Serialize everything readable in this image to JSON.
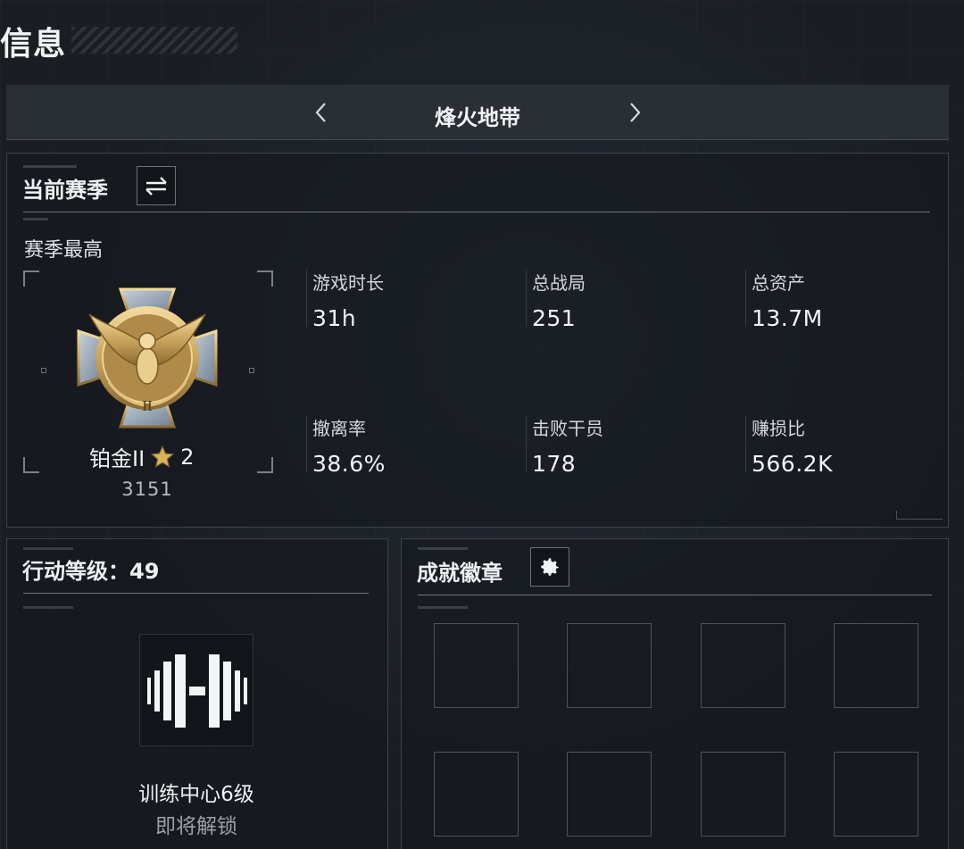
{
  "page": {
    "title": "信息"
  },
  "mode_switcher": {
    "title": "烽火地带"
  },
  "season_panel": {
    "title": "当前赛季",
    "subtitle": "赛季最高",
    "rank": {
      "name": "铂金II",
      "stars": "2",
      "score": "3151",
      "tier_numeral": "II"
    },
    "stats": [
      {
        "label": "游戏时长",
        "value": "31h"
      },
      {
        "label": "总战局",
        "value": "251"
      },
      {
        "label": "总资产",
        "value": "13.7M"
      },
      {
        "label": "撤离率",
        "value": "38.6%"
      },
      {
        "label": "击败干员",
        "value": "178"
      },
      {
        "label": "赚损比",
        "value": "566.2K"
      }
    ]
  },
  "level_panel": {
    "title": "行动等级：49",
    "unlock_name": "训练中心6级",
    "unlock_status": "即将解锁"
  },
  "badges_panel": {
    "title": "成就徽章",
    "slot_count": 8
  },
  "colors": {
    "background": "#1a1e24",
    "panel_border": "#3d434b",
    "gold": "#c9a45c",
    "star": "#d8b45a"
  }
}
